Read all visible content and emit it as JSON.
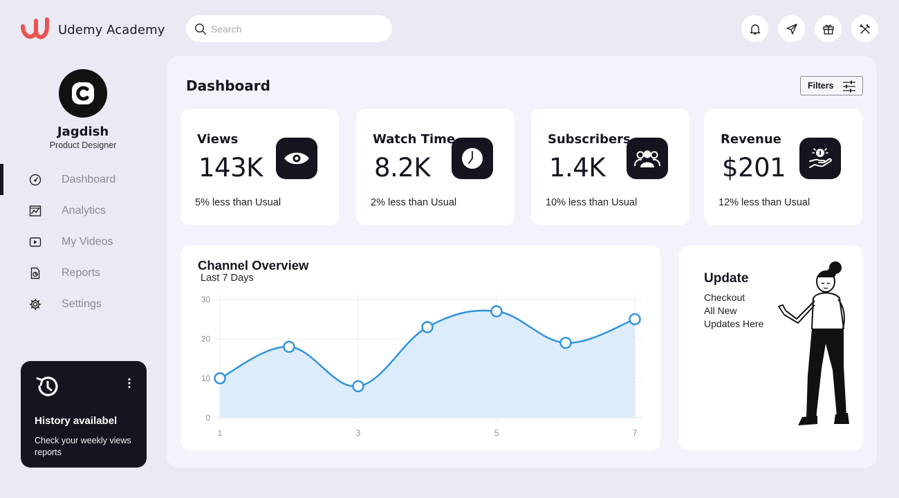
{
  "brand": {
    "name": "Udemy Academy",
    "accent": "#ec5252"
  },
  "profile": {
    "initial": "C",
    "name": "Jagdish",
    "role": "Product Designer"
  },
  "nav": [
    {
      "label": "Dashboard",
      "icon": "speedometer-icon",
      "active": true
    },
    {
      "label": "Analytics",
      "icon": "chart-icon",
      "active": false
    },
    {
      "label": "My Videos",
      "icon": "video-icon",
      "active": false
    },
    {
      "label": "Reports",
      "icon": "report-icon",
      "active": false
    },
    {
      "label": "Settings",
      "icon": "gear-icon",
      "active": false
    }
  ],
  "history": {
    "title": "History availabel",
    "text": "Check your weekly views reports",
    "icon": "history-icon"
  },
  "search": {
    "placeholder": "Search"
  },
  "topbar": {
    "icons": [
      "bell-icon",
      "send-icon",
      "gift-icon",
      "tools-icon"
    ]
  },
  "main": {
    "title": "Dashboard",
    "filters_label": "Filters"
  },
  "stats": [
    {
      "label": "Views",
      "value": "143K",
      "note": "5% less than Usual",
      "icon": "eye-icon"
    },
    {
      "label": "Watch Time",
      "value": "8.2K",
      "note": "2% less than Usual",
      "icon": "clock-icon"
    },
    {
      "label": "Subscribers",
      "value": "1.4K",
      "note": "10% less than Usual",
      "icon": "users-icon"
    },
    {
      "label": "Revenue",
      "value": "$201",
      "note": "12% less than Usual",
      "icon": "revenue-icon"
    }
  ],
  "channel": {
    "title": "Channel Overview",
    "subtitle": "Last 7 Days"
  },
  "chart_data": {
    "type": "area",
    "title": "Channel Overview",
    "subtitle": "Last 7 Days",
    "x": [
      1,
      2,
      3,
      4,
      5,
      6,
      7
    ],
    "y": [
      10,
      18,
      8,
      23,
      27,
      19,
      25
    ],
    "xticks": [
      "1",
      "3",
      "5",
      "7"
    ],
    "yticks": [
      "0",
      "10",
      "20",
      "30"
    ],
    "ylim": [
      0,
      30
    ],
    "grid": true,
    "color": "#2f93de",
    "fill": "#dcecfa"
  },
  "update": {
    "title": "Update",
    "lines": [
      "Checkout",
      "All New",
      "Updates Here"
    ]
  }
}
